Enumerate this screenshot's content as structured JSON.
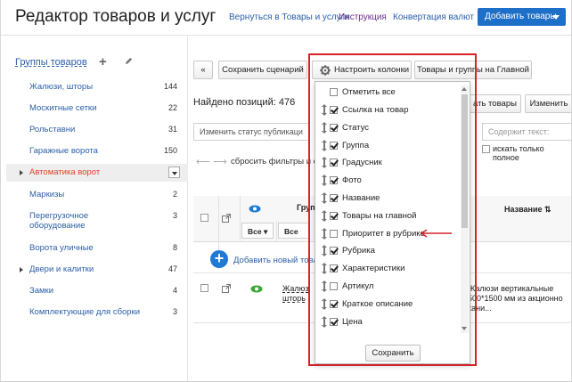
{
  "header": {
    "title": "Редактор товаров и услуг",
    "links": [
      "Вернуться в Товары и услуги",
      "Инструкция",
      "Конвертация валют"
    ],
    "add_button": "Добавить товары"
  },
  "sidebar": {
    "heading": "Группы товаров",
    "items": [
      {
        "label": "Жалюзи, шторы",
        "count": "144"
      },
      {
        "label": "Москитные сетки",
        "count": "22"
      },
      {
        "label": "Рольставни",
        "count": "31"
      },
      {
        "label": "Гаражные ворота",
        "count": "150"
      },
      {
        "label": "Автоматика ворот",
        "count": ""
      },
      {
        "label": "Маркизы",
        "count": "2"
      },
      {
        "label": "Перегрузочное",
        "label2": "оборудование",
        "count": "3"
      },
      {
        "label": "Ворота уличные",
        "count": "8"
      },
      {
        "label": "Двери и калитки",
        "count": "47"
      },
      {
        "label": "Замки",
        "count": "4"
      },
      {
        "label": "Комплектующие для сборки",
        "count": "3"
      }
    ]
  },
  "toolbar": {
    "collapse": "«",
    "save_scenario": "Сохранить сценарий",
    "configure_columns": "Настроить колонки",
    "main_page": "Товары и группы на Главной"
  },
  "found": "Найдено позиций: 476",
  "actions": {
    "change_status": "Изменить статус публикаци",
    "goods_btn": "ать товары",
    "change_btn": "Изменить",
    "search_placeholder": "Содержит текст:",
    "search_full": "искать только полное",
    "reset": "сбросить фильтры и со"
  },
  "table": {
    "header_group": "Груп",
    "header_name": "Название ⇅",
    "filter_all_1": "Все",
    "filter_all_2": "Все",
    "add_new": "Добавить новый това",
    "row1_group_1": "Жалюз",
    "row1_group_2": "шторь",
    "row1_name_1": "Жалюзи вертикальные",
    "row1_name_2": "500*1500 мм из акционно",
    "row1_name_3": "кани..."
  },
  "columns_dropdown": {
    "select_all": "Отметить все",
    "items": [
      {
        "label": "Ссылка на товар",
        "checked": true
      },
      {
        "label": "Статус",
        "checked": true
      },
      {
        "label": "Группа",
        "checked": true
      },
      {
        "label": "Градусник",
        "checked": true
      },
      {
        "label": "Фото",
        "checked": true
      },
      {
        "label": "Название",
        "checked": true
      },
      {
        "label": "Товары на главной",
        "checked": true
      },
      {
        "label": "Приоритет в рубрике",
        "checked": false
      },
      {
        "label": "Рубрика",
        "checked": true
      },
      {
        "label": "Характеристики",
        "checked": true
      },
      {
        "label": "Артикул",
        "checked": false
      },
      {
        "label": "Краткое описание",
        "checked": true
      },
      {
        "label": "Цена",
        "checked": true
      }
    ],
    "save": "Сохранить"
  },
  "colors": {
    "accent": "#1e6fc7",
    "highlight": "#d4242a",
    "active_text": "#e0402a",
    "eye": "#1e7ad4"
  }
}
